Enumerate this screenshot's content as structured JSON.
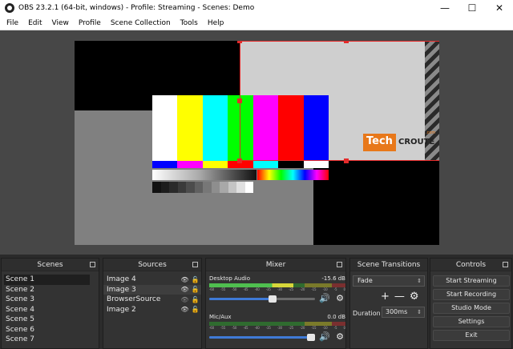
{
  "window": {
    "title": "OBS 23.2.1 (64-bit, windows) - Profile: Streaming - Scenes: Demo",
    "minimize": "—",
    "maximize": "☐",
    "close": "✕"
  },
  "menu": [
    "File",
    "Edit",
    "View",
    "Profile",
    "Scene Collection",
    "Tools",
    "Help"
  ],
  "preview": {
    "logo_text_a": "Tech",
    "logo_text_b": "CROUTE",
    "logo_text_c": ".com"
  },
  "docks": {
    "scenes": {
      "title": "Scenes",
      "items": [
        "Scene 1",
        "Scene 2",
        "Scene 3",
        "Scene 4",
        "Scene 5",
        "Scene 6",
        "Scene 7"
      ],
      "selected_index": 0
    },
    "sources": {
      "title": "Sources",
      "items": [
        "Image 4",
        "Image 3",
        "BrowserSource",
        "Image 2"
      ],
      "selected_index": 1
    },
    "mixer": {
      "title": "Mixer",
      "tracks": [
        {
          "name": "Desktop Audio",
          "db": "-15.6 dB",
          "level": 0.62,
          "volume": 0.64
        },
        {
          "name": "Mic/Aux",
          "db": "0.0 dB",
          "level": 0.0,
          "volume": 1.0
        }
      ],
      "ticks": [
        "-60",
        "-55",
        "-50",
        "-45",
        "-40",
        "-35",
        "-30",
        "-25",
        "-20",
        "-15",
        "-10",
        "-5",
        "0"
      ]
    },
    "transitions": {
      "title": "Scene Transitions",
      "selected": "Fade",
      "add": "+",
      "remove": "—",
      "duration_label": "Duration",
      "duration_value": "300ms"
    },
    "controls": {
      "title": "Controls",
      "buttons": [
        "Start Streaming",
        "Start Recording",
        "Studio Mode",
        "Settings",
        "Exit"
      ]
    }
  },
  "colors": {
    "selection": "#e52a2a",
    "accent": "#3f7ad6",
    "logo_orange": "#e8781a"
  }
}
